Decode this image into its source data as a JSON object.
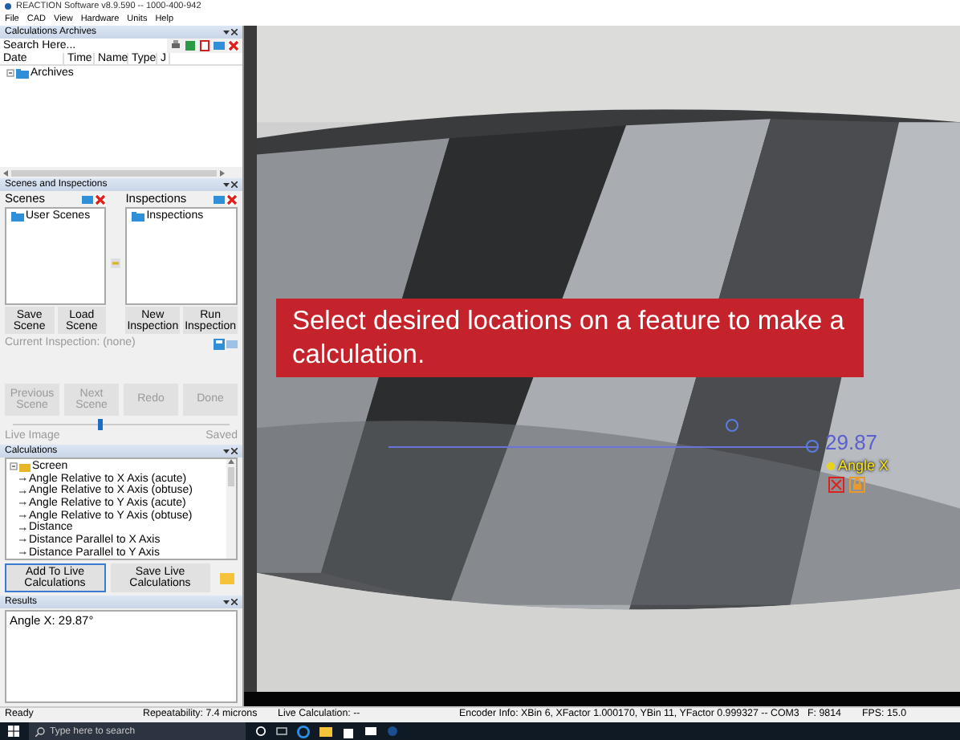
{
  "window": {
    "title": "REACTION Software v8.9.590 -- 1000-400-942"
  },
  "menu": [
    "File",
    "CAD",
    "View",
    "Hardware",
    "Units",
    "Help"
  ],
  "archives": {
    "title": "Calculations Archives",
    "search": {
      "placeholder": "Search Here..."
    },
    "columns": [
      "Date",
      "Time",
      "Name",
      "Type",
      "J"
    ],
    "tree": [
      {
        "label": "Archives"
      }
    ]
  },
  "scenes_inspections": {
    "title": "Scenes and Inspections",
    "panes": [
      {
        "title": "Scenes",
        "items": [
          {
            "label": "User Scenes"
          }
        ],
        "buttons": [
          "Save Scene",
          "Load Scene"
        ]
      },
      {
        "title": "Inspections",
        "items": [
          {
            "label": "Inspections"
          }
        ],
        "buttons": [
          "New Inspection",
          "Run Inspection"
        ]
      }
    ],
    "current_inspection": "Current Inspection: (none)"
  },
  "scene_nav": {
    "buttons": [
      {
        "label": "Previous Scene",
        "disabled": true
      },
      {
        "label": "Next Scene",
        "disabled": true
      },
      {
        "label": "Redo",
        "disabled": true
      },
      {
        "label": "Done",
        "disabled": true
      }
    ],
    "slider": {
      "level": 0.4
    },
    "left_label": "Live Image",
    "right_label": "Saved"
  },
  "calculations": {
    "title": "Calculations",
    "tree": [
      {
        "label": "Screen",
        "children": [
          {
            "label": "Angle Relative to X Axis (acute)"
          },
          {
            "label": "Angle Relative to X Axis (obtuse)"
          },
          {
            "label": "Angle Relative to Y Axis (acute)"
          },
          {
            "label": "Angle Relative to Y Axis (obtuse)"
          },
          {
            "label": "Distance"
          },
          {
            "label": "Distance Parallel to X Axis"
          },
          {
            "label": "Distance Parallel to Y Axis"
          }
        ]
      }
    ],
    "buttons": [
      "Add To Live Calculations",
      "Save Live Calculations"
    ]
  },
  "results": {
    "title": "Results",
    "lines": [
      "Angle X:  29.87°"
    ]
  },
  "viewer": {
    "message": "Select desired locations on a feature to make a calculation.",
    "measurement": {
      "value": "29.87",
      "label": "Angle X"
    }
  },
  "status_bar": {
    "state": "Ready",
    "repeatability": "Repeatability: 7.4 microns",
    "live_calculation": "Live Calculation: --",
    "encoder": "Encoder Info: XBin 6, XFactor 1.000170, YBin 11, YFactor 0.999327 -- COM3",
    "frame": "F: 9814",
    "fps": "FPS: 15.0"
  },
  "taskbar": {
    "search": {
      "placeholder": "Type here to search"
    }
  }
}
